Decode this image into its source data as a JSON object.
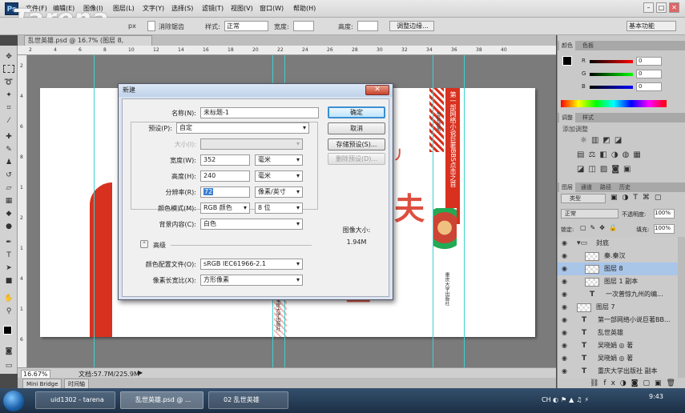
{
  "app": {
    "logo": "Ps",
    "watermark": "Tarena"
  },
  "menu": [
    "文件(F)",
    "编辑(E)",
    "图像(I)",
    "图层(L)",
    "文字(Y)",
    "选择(S)",
    "滤镜(T)",
    "视图(V)",
    "窗口(W)",
    "帮助(H)"
  ],
  "options": {
    "feather_tail": "px",
    "antialias": "消除锯齿",
    "style_label": "样式:",
    "style_value": "正常",
    "width_label": "宽度:",
    "height_label": "高度:",
    "refine_button": "调整边缘...",
    "workspace": "基本功能"
  },
  "document": {
    "tab_title": "乱世英雄.psd @ 16.7% (图层 8, CMYK/8)",
    "zoom": "16.67%",
    "doc_size": "文档:57.7M/225.9M"
  },
  "ruler": {
    "top": [
      "2",
      "4",
      "6",
      "8",
      "10",
      "12",
      "14",
      "16",
      "18",
      "20",
      "22",
      "24",
      "26",
      "28",
      "30",
      "32",
      "34",
      "36",
      "38",
      "40"
    ],
    "left": [
      "2",
      "4",
      "6",
      "8",
      "1",
      "2",
      "1",
      "4",
      "1",
      "6"
    ]
  },
  "minibridge": {
    "tab1": "Mini Bridge",
    "tab2": "时间轴"
  },
  "colors": {
    "accent_red": "#d8311f",
    "guide": "#3fd0d0",
    "dialog_bg": "#f0f0f0",
    "selection": "#a9c5e8"
  },
  "artwork": {
    "spine_text": "第一部网络小说巨著BBS点击之首",
    "publisher": "重庆大学出版社",
    "small_vert": "鲁敦敦著",
    "small_vert2": "重庆大学出版社"
  },
  "dialog": {
    "title": "新建",
    "close": "✕",
    "name_label": "名称(N):",
    "name_value": "未标题-1",
    "preset_label": "预设(P):",
    "preset_value": "自定",
    "size_label": "大小(I):",
    "size_value": "",
    "width_label": "宽度(W):",
    "width_value": "352",
    "width_unit": "毫米",
    "height_label": "高度(H):",
    "height_value": "240",
    "height_unit": "毫米",
    "res_label": "分辨率(R):",
    "res_value": "72",
    "res_unit": "像素/英寸",
    "mode_label": "颜色模式(M):",
    "mode_value": "RGB 颜色",
    "bit_value": "8 位",
    "bg_label": "背景内容(C):",
    "bg_value": "白色",
    "advanced_label": "高级",
    "profile_label": "颜色配置文件(O):",
    "profile_value": "sRGB IEC61966-2.1",
    "aspect_label": "像素长宽比(X):",
    "aspect_value": "方形像素",
    "ok": "确定",
    "cancel": "取消",
    "save_preset": "存储预设(S)...",
    "delete_preset": "删除预设(D)...",
    "imgsize_label": "图像大小:",
    "imgsize_value": "1.94M"
  },
  "panels": {
    "color_tabs": [
      "颜色",
      "色板"
    ],
    "color_values": [
      "0",
      "0",
      "0"
    ],
    "adjust_tabs": [
      "调整",
      "样式"
    ],
    "adjust_title": "添加调整",
    "layer_tabs": [
      "图层",
      "通道",
      "路径",
      "历史"
    ],
    "kind": "类型",
    "blend": "正常",
    "opacity_label": "不透明度:",
    "opacity_value": "100%",
    "lock_label": "锁定:",
    "fill_label": "填充:",
    "fill_value": "100%",
    "layers": [
      {
        "name": "封底",
        "kind": "group"
      },
      {
        "name": "秦.秦汉",
        "kind": "pixel"
      },
      {
        "name": "图层 8",
        "kind": "pixel",
        "selected": true
      },
      {
        "name": "图层 1 副本",
        "kind": "pixel"
      },
      {
        "name": "一次普惊九州的编...",
        "kind": "text"
      },
      {
        "name": "图层 7",
        "kind": "pixel"
      },
      {
        "name": "第一部网络小说巨著BB...",
        "kind": "text"
      },
      {
        "name": "乱世英雄",
        "kind": "text"
      },
      {
        "name": "吴晓娟 ◎ 著",
        "kind": "text"
      },
      {
        "name": "吴晓娟 ◎ 著",
        "kind": "text"
      },
      {
        "name": "重庆大学出版社 副本",
        "kind": "text"
      }
    ]
  },
  "taskbar": {
    "items": [
      "uid1302 - tarena",
      "乱世英雄.psd @ ...",
      "02 乱世英雄"
    ],
    "lang": "CH",
    "time": "9:43"
  }
}
